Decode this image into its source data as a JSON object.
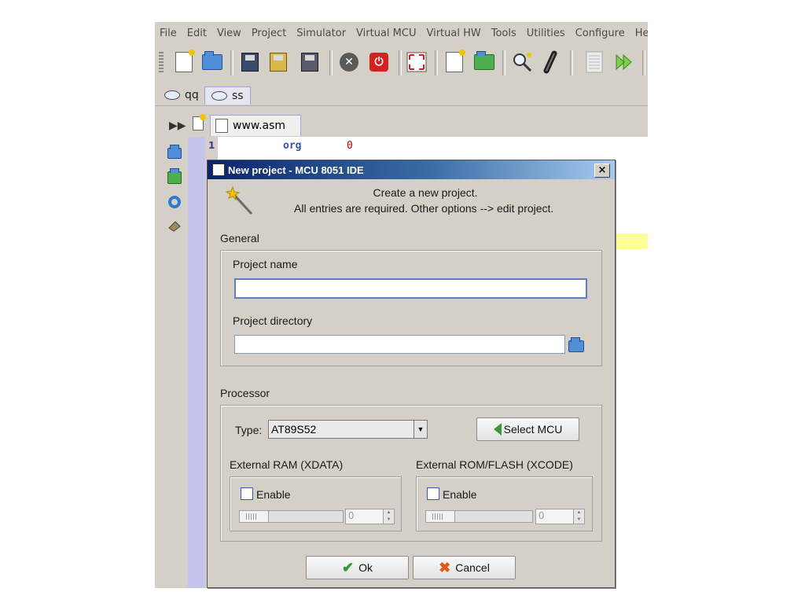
{
  "menubar": {
    "items": [
      "File",
      "Edit",
      "View",
      "Project",
      "Simulator",
      "Virtual MCU",
      "Virtual HW",
      "Tools",
      "Utilities",
      "Configure",
      "Help"
    ]
  },
  "project_tabs": [
    {
      "label": "qq"
    },
    {
      "label": "ss"
    }
  ],
  "editor": {
    "file_tab": "www.asm",
    "line_number": "1",
    "code_keyword": "org",
    "code_value": "0"
  },
  "dialog": {
    "title": "New project - MCU 8051 IDE",
    "close_label": "×",
    "intro_line1": "Create a new project.",
    "intro_line2": "All entries are required. Other options --> edit project.",
    "general": {
      "heading": "General",
      "project_name_label": "Project name",
      "project_name_value": "",
      "project_directory_label": "Project directory",
      "project_directory_value": ""
    },
    "processor": {
      "heading": "Processor",
      "type_label": "Type:",
      "type_value": "AT89S52",
      "select_mcu_label": "Select MCU",
      "external_ram": {
        "heading": "External RAM (XDATA)",
        "enable_label": "Enable",
        "enabled": false,
        "value": "0"
      },
      "external_rom": {
        "heading": "External ROM/FLASH (XCODE)",
        "enable_label": "Enable",
        "enabled": false,
        "value": "0"
      }
    },
    "ok_label": "Ok",
    "cancel_label": "Cancel"
  },
  "colors": {
    "window_bg": "#d4d0c8",
    "titlebar_start": "#0a246a",
    "titlebar_end": "#a6caf0",
    "gutter": "#c4c4ec",
    "keyword": "#3b52a8",
    "number": "#b00000",
    "highlight": "#ffff99"
  }
}
